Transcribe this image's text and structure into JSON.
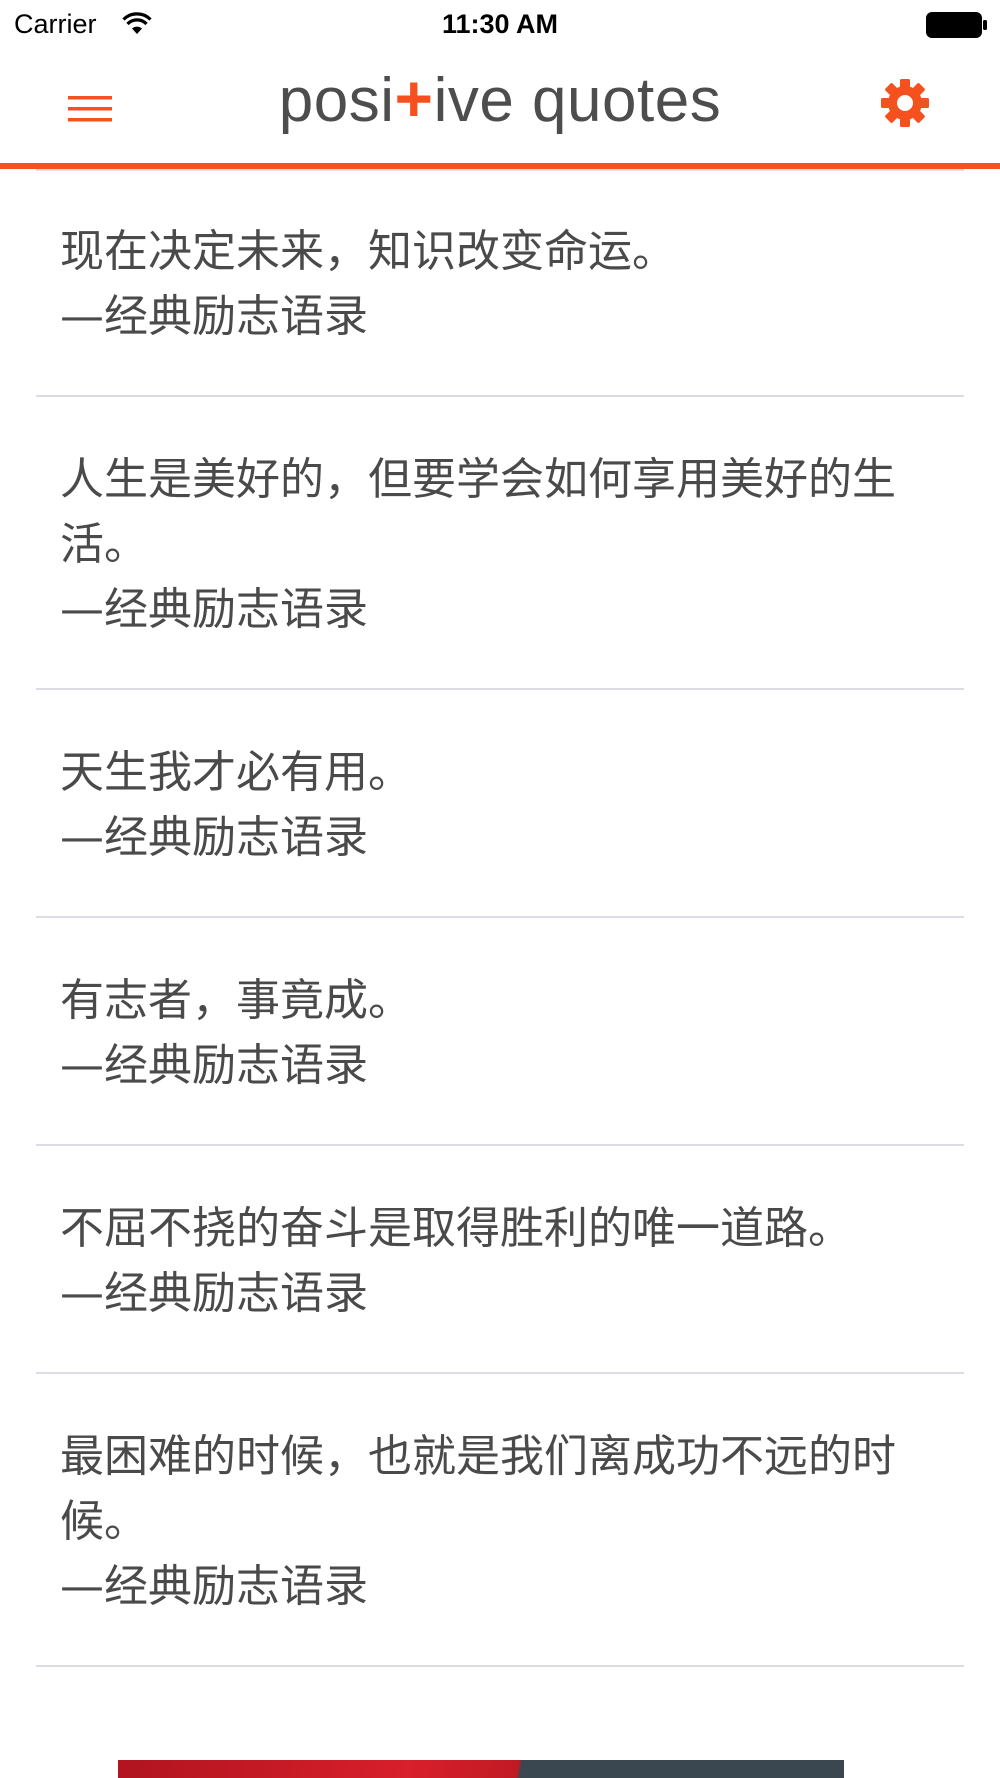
{
  "status_bar": {
    "carrier": "Carrier",
    "time": "11:30 AM",
    "wifi_icon": "wifi-icon",
    "battery_icon": "battery-icon"
  },
  "nav": {
    "logo_part1": "posi",
    "logo_plus": "+",
    "logo_part2": "ive quotes",
    "menu_icon": "hamburger-menu-icon",
    "settings_icon": "gear-icon",
    "accent_color": "#f4511e"
  },
  "quotes": [
    {
      "text": "现在决定未来，知识改变命运。",
      "author": "—经典励志语录"
    },
    {
      "text": "人生是美好的，但要学会如何享用美好的生活。",
      "author": "—经典励志语录"
    },
    {
      "text": "天生我才必有用。",
      "author": "—经典励志语录"
    },
    {
      "text": "有志者，事竟成。",
      "author": "—经典励志语录"
    },
    {
      "text": "不屈不挠的奋斗是取得胜利的唯一道路。",
      "author": "—经典励志语录"
    },
    {
      "text": "最困难的时候，也就是我们离成功不远的时候。",
      "author": "—经典励志语录"
    }
  ]
}
